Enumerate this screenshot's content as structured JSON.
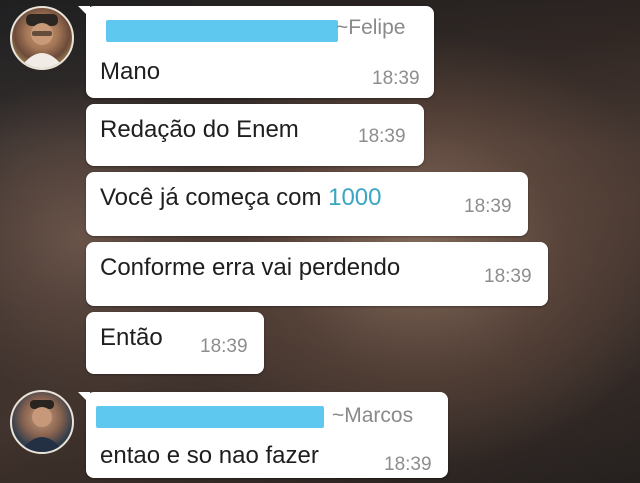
{
  "chat": {
    "groups": [
      {
        "sender": "~Felipe",
        "messages": [
          {
            "text": "Mano",
            "time": "18:39"
          },
          {
            "text": "Redação do Enem",
            "time": "18:39"
          },
          {
            "text_before": "Você já começa com ",
            "text_highlight": "1000",
            "time": "18:39"
          },
          {
            "text": "Conforme erra vai perdendo",
            "time": "18:39"
          },
          {
            "text": "Então",
            "time": "18:39"
          }
        ]
      },
      {
        "sender": "~Marcos",
        "messages": [
          {
            "text": "entao e so nao fazer",
            "time": "18:39"
          }
        ]
      }
    ]
  },
  "colors": {
    "bubble": "#ffffff",
    "redaction_bar": "#5ec8ee",
    "link_number": "#3aa6c4",
    "time": "#8d8d8d",
    "sender": "#8a8a8a"
  },
  "icons": {
    "avatar_felipe": "avatar",
    "avatar_marcos": "avatar"
  }
}
